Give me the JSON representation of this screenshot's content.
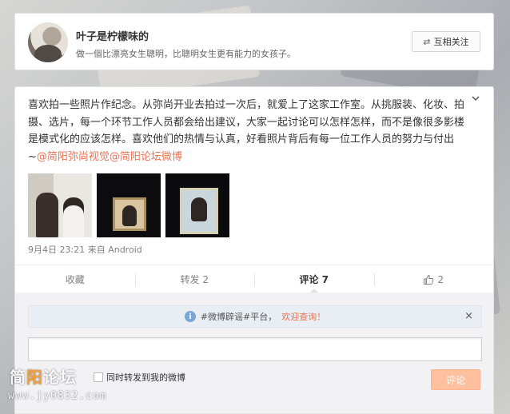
{
  "profile": {
    "name": "叶子是柠檬味的",
    "bio": "做一個比漂亮女生聰明，比聰明女生更有能力的女孩子。",
    "follow_label": "互相关注",
    "follow_icon": "mutual-follow-icon"
  },
  "post": {
    "text_before": "喜欢拍一些照片作纪念。从弥尚开业去拍过一次后，就爱上了这家工作室。从挑服装、化妆、拍摄、选片，每一个环节工作人员都会给出建议，大家一起讨论可以怎样怎样，而不是像很多影楼是模式化的应该怎样。喜欢他们的热情与认真，好看照片背后有每一位工作人员的努力与付出~",
    "mentions": [
      "@简阳弥尚视觉",
      "@简阳论坛微博"
    ],
    "time": "9月4日 23:21",
    "source_prefix": "来自",
    "source": "Android",
    "images": [
      {
        "icon": "photo-people-icon"
      },
      {
        "icon": "photo-frame-icon"
      },
      {
        "icon": "photo-frame-icon"
      }
    ]
  },
  "actions": {
    "favorite": "收藏",
    "repost": "转发 2",
    "comment": "评论 7",
    "like_count": "2"
  },
  "comment": {
    "notice_text": "#微博辟谣#平台，",
    "notice_link": "欢迎查询！",
    "notice_close": "×",
    "input_value": "",
    "repost_label": "同时转发到我的微博",
    "submit_label": "评论"
  },
  "watermark": {
    "logo": "简阳论坛",
    "url": "www.jy0832.com"
  },
  "colors": {
    "accent": "#eb7350",
    "submit_bg": "#ffc09f",
    "notice_bg": "#e8eef4"
  }
}
